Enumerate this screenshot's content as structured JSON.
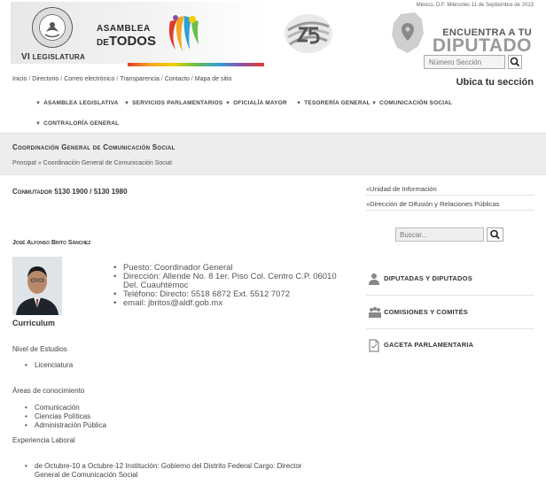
{
  "header": {
    "legislatura_prefix": "VI",
    "legislatura_label": "LEGISLATURA",
    "logo_line1": "ASAMBLEA",
    "logo_line2_de": "DE",
    "logo_line2_todos": "TODOS",
    "date": "México, D.F. Miércoles 11 de Septiembre de 2013",
    "encuentra": "ENCUENTRA A TU",
    "diputado": "DIPUTADO",
    "seccion_placeholder": "Número Sección",
    "ubica": "Ubica tu sección"
  },
  "top_links": [
    "Inicio",
    "Directorio",
    "Correo electrónico",
    "Transparencia",
    "Contacto",
    "Mapa de sitio"
  ],
  "nav": {
    "items": [
      "ASAMBLEA LEGISLATIVA",
      "SERVICIOS PARLAMENTARIOS",
      "OFICIALÍA MAYOR",
      "TESORERÍA GENERAL",
      "COMUNICACIÓN SOCIAL",
      "CONTRALORÍA GENERAL"
    ]
  },
  "band": {
    "title": "Coordinación General de Comunicación Social",
    "breadcrumb_home": "Principal",
    "breadcrumb_sep": "»",
    "breadcrumb_current": "Coordinación General de Comunicación Social"
  },
  "content": {
    "conmutador": "Conmutador 5130 1900 / 5130 1980",
    "person_name": "José Alfonso Brito Sánchez",
    "details": [
      "Puesto: Coordinador General",
      "Dirección: Allende No. 8 1er. Piso Col. Centro C.P. 06010",
      "Del. Cuauhtémoc",
      "Teléfono: Directo: 5518 6872  Ext. 5512 7072",
      "email: jbritos@aldf.gob.mx"
    ],
    "curriculum": "Curriculum",
    "nivel_label": "Nivel de Estudios",
    "nivel": [
      "Licenciatura"
    ],
    "areas_label": "Áreas de conocimiento",
    "areas": [
      "Comunicación",
      "Ciencias Políticas",
      "Administración Pública"
    ],
    "experiencia_label": "Experiencia Laboral",
    "experiencia": [
      "de Octubre-10 a Octubre-12 Institución: Gobierno del Distrito Federal Cargo: Director",
      "General de Comunicación Social"
    ]
  },
  "sidebar": {
    "links": [
      "»Unidad de Información",
      "»Dirección de Difusión y Relaciones Públicas"
    ],
    "search_placeholder": "Buscar...",
    "sections": [
      "DIPUTADAS Y DIPUTADOS",
      "COMISIONES Y COMITÉS",
      "GACETA PARLAMENTARIA"
    ]
  }
}
